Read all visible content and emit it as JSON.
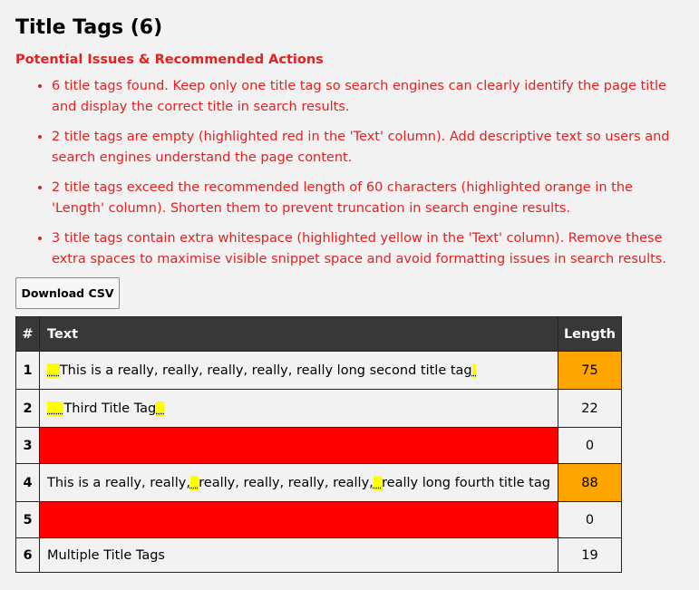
{
  "page": {
    "title": "Title Tags (6)"
  },
  "issues": {
    "heading": "Potential Issues & Recommended Actions",
    "items": [
      "6 title tags found. Keep only one title tag so search engines can clearly identify the page title and display the correct title in search results.",
      "2 title tags are empty (highlighted red in the 'Text' column). Add descriptive text so users and search engines understand the page content.",
      "2 title tags exceed the recommended length of 60 characters (highlighted orange in the 'Length' column). Shorten them to prevent truncation in search engine results.",
      "3 title tags contain extra whitespace (highlighted yellow in the 'Text' column). Remove these extra spaces to maximise visible snippet space and avoid formatting issues in search results."
    ]
  },
  "toolbar": {
    "download_label": "Download CSV"
  },
  "table": {
    "headers": {
      "index": "#",
      "text": "Text",
      "length": "Length"
    },
    "rows": [
      {
        "index": "1",
        "text_segments": [
          {
            "text": "   ",
            "whitespace": true
          },
          {
            "text": "This is a really, really, really, really, really long second title tag",
            "whitespace": false
          },
          {
            "text": " ",
            "whitespace": true
          }
        ],
        "length": "75"
      },
      {
        "index": "2",
        "text_segments": [
          {
            "text": "    ",
            "whitespace": true
          },
          {
            "text": "Third Title Tag",
            "whitespace": false
          },
          {
            "text": "  ",
            "whitespace": true
          }
        ],
        "length": "22"
      },
      {
        "index": "3",
        "text_segments": [],
        "length": "0"
      },
      {
        "index": "4",
        "text_segments": [
          {
            "text": "This is a really, really,",
            "whitespace": false
          },
          {
            "text": "  ",
            "whitespace": true
          },
          {
            "text": "really, really, really, really,",
            "whitespace": false
          },
          {
            "text": "  ",
            "whitespace": true
          },
          {
            "text": "really long fourth title tag",
            "whitespace": false
          }
        ],
        "length": "88"
      },
      {
        "index": "5",
        "text_segments": [],
        "length": "0"
      },
      {
        "index": "6",
        "text_segments": [
          {
            "text": "Multiple Title Tags",
            "whitespace": false
          }
        ],
        "length": "19"
      }
    ]
  },
  "colors": {
    "issue_text": "#e52020",
    "header_bg": "#383838",
    "empty_highlight": "#ff0000",
    "length_highlight": "#ffa500",
    "whitespace_highlight": "#ffff00"
  }
}
